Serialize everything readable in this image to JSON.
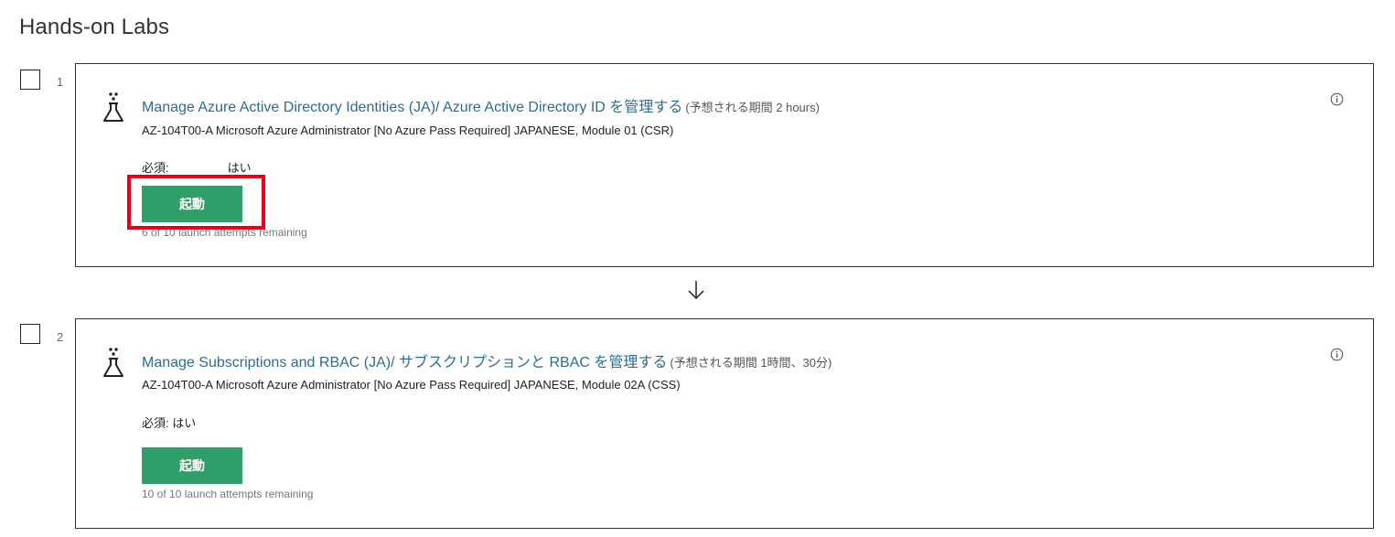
{
  "page": {
    "title": "Hands-on Labs"
  },
  "icons": {
    "lab": "flask-icon",
    "info": "info-icon",
    "next_step": "arrow-down-icon"
  },
  "colors": {
    "link": "#2e6b8f",
    "launch_button": "#2f9e69",
    "highlight": "#e3001b"
  },
  "labs": [
    {
      "number": "1",
      "title": "Manage Azure Active Directory Identities (JA)/ Azure Active Directory ID を管理する",
      "duration": "(予想される期間 2 hours)",
      "course": "AZ-104T00-A Microsoft Azure Administrator [No Azure Pass Required] JAPANESE, Module 01 (CSR)",
      "required_label": "必須:",
      "required_value": "はい",
      "launch_label": "起動",
      "attempts": "6 of 10 launch attempts remaining",
      "highlighted": true
    },
    {
      "number": "2",
      "title": "Manage Subscriptions and RBAC (JA)/ サブスクリプションと RBAC を管理する",
      "duration": "(予想される期間 1時間、30分)",
      "course": "AZ-104T00-A Microsoft Azure Administrator [No Azure Pass Required] JAPANESE, Module 02A (CSS)",
      "required_label": "必須:",
      "required_value": "はい",
      "launch_label": "起動",
      "attempts": "10 of 10 launch attempts remaining",
      "highlighted": false
    }
  ]
}
